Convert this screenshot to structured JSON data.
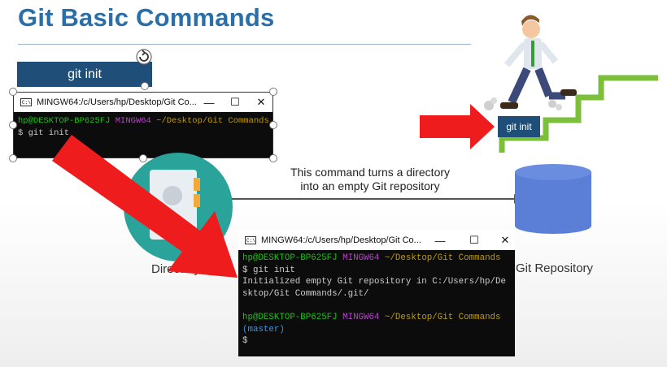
{
  "slide": {
    "title": "Git Basic Commands",
    "command_pill": "git init",
    "caption_line1": "This command turns a directory",
    "caption_line2": "into an empty Git repository",
    "directory_label": "Directory",
    "repository_label": "Git Repository",
    "hero_badge": "git init"
  },
  "small_terminal": {
    "title": "MINGW64:/c/Users/hp/Desktop/Git Co...",
    "prompt_user": "hp@DESKTOP-BP625FJ",
    "prompt_env": "MINGW64",
    "prompt_path": "~/Desktop/Git Commands",
    "command_line": "$ git init"
  },
  "large_terminal": {
    "title": "MINGW64:/c/Users/hp/Desktop/Git Co...",
    "prompt_user": "hp@DESKTOP-BP625FJ",
    "prompt_env": "MINGW64",
    "prompt_path": "~/Desktop/Git Commands",
    "command_line": "$ git init",
    "output_line1": "Initialized empty Git repository in C:/Users/hp/De",
    "output_line2": "sktop/Git Commands/.git/",
    "prompt2_user": "hp@DESKTOP-BP625FJ",
    "prompt2_env": "MINGW64",
    "prompt2_path": "~/Desktop/Git Commands",
    "branch": "(master)",
    "cursor_line": "$"
  },
  "window_controls": {
    "minimize": "—",
    "maximize": "☐",
    "close": "✕"
  },
  "icons": [
    "rotate-icon",
    "terminal-app-icon",
    "folder-icon",
    "repository-cylinder-icon",
    "red-arrow-icon",
    "cartoon-man-stairs-illustration"
  ],
  "colors": {
    "title": "#2b6fa8",
    "pill": "#1f4e79",
    "arrow": "#ee1c1c",
    "teal": "#2aa39a",
    "stairs": "#7bbf3a",
    "repo": "#5b7fd6"
  }
}
